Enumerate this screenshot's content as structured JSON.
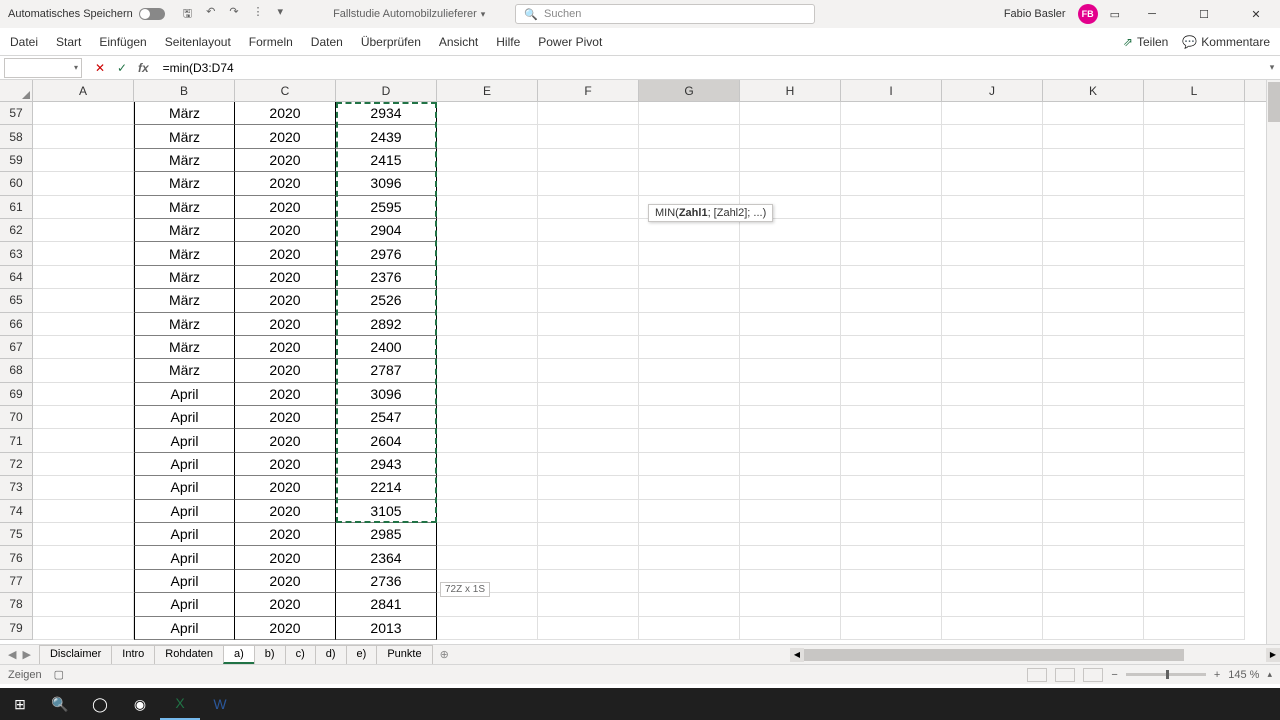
{
  "titlebar": {
    "autosave_label": "Automatisches Speichern",
    "doc_title": "Fallstudie Automobilzulieferer",
    "search_placeholder": "Suchen",
    "user_name": "Fabio Basler",
    "user_initials": "FB"
  },
  "ribbon": {
    "tabs": [
      "Datei",
      "Start",
      "Einfügen",
      "Seitenlayout",
      "Formeln",
      "Daten",
      "Überprüfen",
      "Ansicht",
      "Hilfe",
      "Power Pivot"
    ],
    "share": "Teilen",
    "comments": "Kommentare"
  },
  "formula_bar": {
    "name_box": "",
    "formula": "=min(D3:D74"
  },
  "columns": [
    "A",
    "B",
    "C",
    "D",
    "E",
    "F",
    "G",
    "H",
    "I",
    "J",
    "K",
    "L"
  ],
  "active_column": "G",
  "row_start": 57,
  "rows": [
    {
      "n": 57,
      "b": "März",
      "c": "2020",
      "d": "2934"
    },
    {
      "n": 58,
      "b": "März",
      "c": "2020",
      "d": "2439"
    },
    {
      "n": 59,
      "b": "März",
      "c": "2020",
      "d": "2415"
    },
    {
      "n": 60,
      "b": "März",
      "c": "2020",
      "d": "3096"
    },
    {
      "n": 61,
      "b": "März",
      "c": "2020",
      "d": "2595"
    },
    {
      "n": 62,
      "b": "März",
      "c": "2020",
      "d": "2904"
    },
    {
      "n": 63,
      "b": "März",
      "c": "2020",
      "d": "2976"
    },
    {
      "n": 64,
      "b": "März",
      "c": "2020",
      "d": "2376"
    },
    {
      "n": 65,
      "b": "März",
      "c": "2020",
      "d": "2526"
    },
    {
      "n": 66,
      "b": "März",
      "c": "2020",
      "d": "2892"
    },
    {
      "n": 67,
      "b": "März",
      "c": "2020",
      "d": "2400"
    },
    {
      "n": 68,
      "b": "März",
      "c": "2020",
      "d": "2787"
    },
    {
      "n": 69,
      "b": "April",
      "c": "2020",
      "d": "3096"
    },
    {
      "n": 70,
      "b": "April",
      "c": "2020",
      "d": "2547"
    },
    {
      "n": 71,
      "b": "April",
      "c": "2020",
      "d": "2604"
    },
    {
      "n": 72,
      "b": "April",
      "c": "2020",
      "d": "2943"
    },
    {
      "n": 73,
      "b": "April",
      "c": "2020",
      "d": "2214"
    },
    {
      "n": 74,
      "b": "April",
      "c": "2020",
      "d": "3105"
    },
    {
      "n": 75,
      "b": "April",
      "c": "2020",
      "d": "2985"
    },
    {
      "n": 76,
      "b": "April",
      "c": "2020",
      "d": "2364"
    },
    {
      "n": 77,
      "b": "April",
      "c": "2020",
      "d": "2736"
    },
    {
      "n": 78,
      "b": "April",
      "c": "2020",
      "d": "2841"
    },
    {
      "n": 79,
      "b": "April",
      "c": "2020",
      "d": "2013"
    }
  ],
  "marching_end_row": 74,
  "tooltip": {
    "fn": "MIN(",
    "arg1": "Zahl1",
    "rest": "; [Zahl2]; ...)"
  },
  "selection_size": "72Z x 1S",
  "sheets": [
    "Disclaimer",
    "Intro",
    "Rohdaten",
    "a)",
    "b)",
    "c)",
    "d)",
    "e)",
    "Punkte"
  ],
  "active_sheet": "a)",
  "status": {
    "mode": "Zeigen",
    "zoom": "145 %"
  }
}
